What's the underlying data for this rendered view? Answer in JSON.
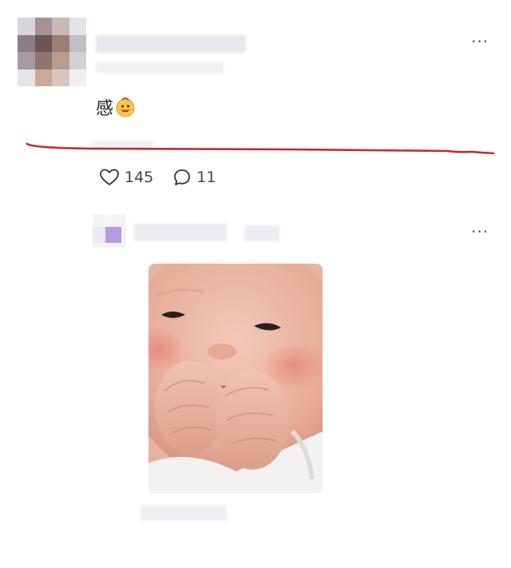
{
  "first_comment": {
    "text": "感",
    "emoji_icon": "smiling-face-emoji-icon",
    "more_icon": "more-options-icon",
    "more_label": "···",
    "likes": "145",
    "replies": "11",
    "like_icon": "heart-icon",
    "reply_icon": "comment-bubble-icon"
  },
  "second_comment": {
    "more_icon": "more-options-icon",
    "more_label": "···",
    "image_subject": "baby"
  },
  "colors": {
    "annotation_line": "#c8282a",
    "text": "#333333",
    "background": "#ffffff"
  }
}
